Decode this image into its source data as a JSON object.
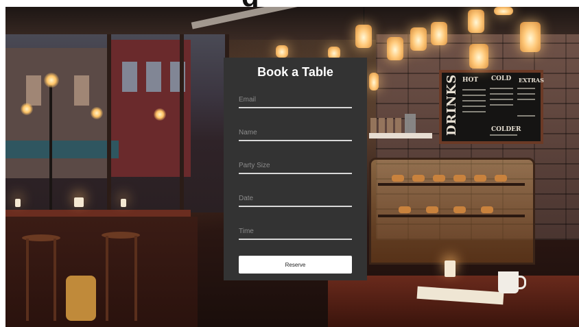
{
  "page": {
    "partial_heading": "g"
  },
  "form": {
    "title": "Book a Table",
    "fields": [
      {
        "name": "email",
        "placeholder": "Email",
        "value": ""
      },
      {
        "name": "name",
        "placeholder": "Name",
        "value": ""
      },
      {
        "name": "party_size",
        "placeholder": "Party Size",
        "value": ""
      },
      {
        "name": "date",
        "placeholder": "Date",
        "value": ""
      },
      {
        "name": "time",
        "placeholder": "Time",
        "value": ""
      }
    ],
    "submit_label": "Reserve"
  },
  "background": {
    "chalkboard": {
      "big_word": "DRINKS",
      "headings": [
        "HOT",
        "COLD",
        "EXTRAS",
        "COLDER"
      ]
    }
  },
  "colors": {
    "card": "#333333",
    "card_text": "#ffffff",
    "placeholder": "#8c8c8c",
    "underline": "#d9d9d9",
    "button_bg": "#ffffff",
    "button_text": "#222222"
  }
}
